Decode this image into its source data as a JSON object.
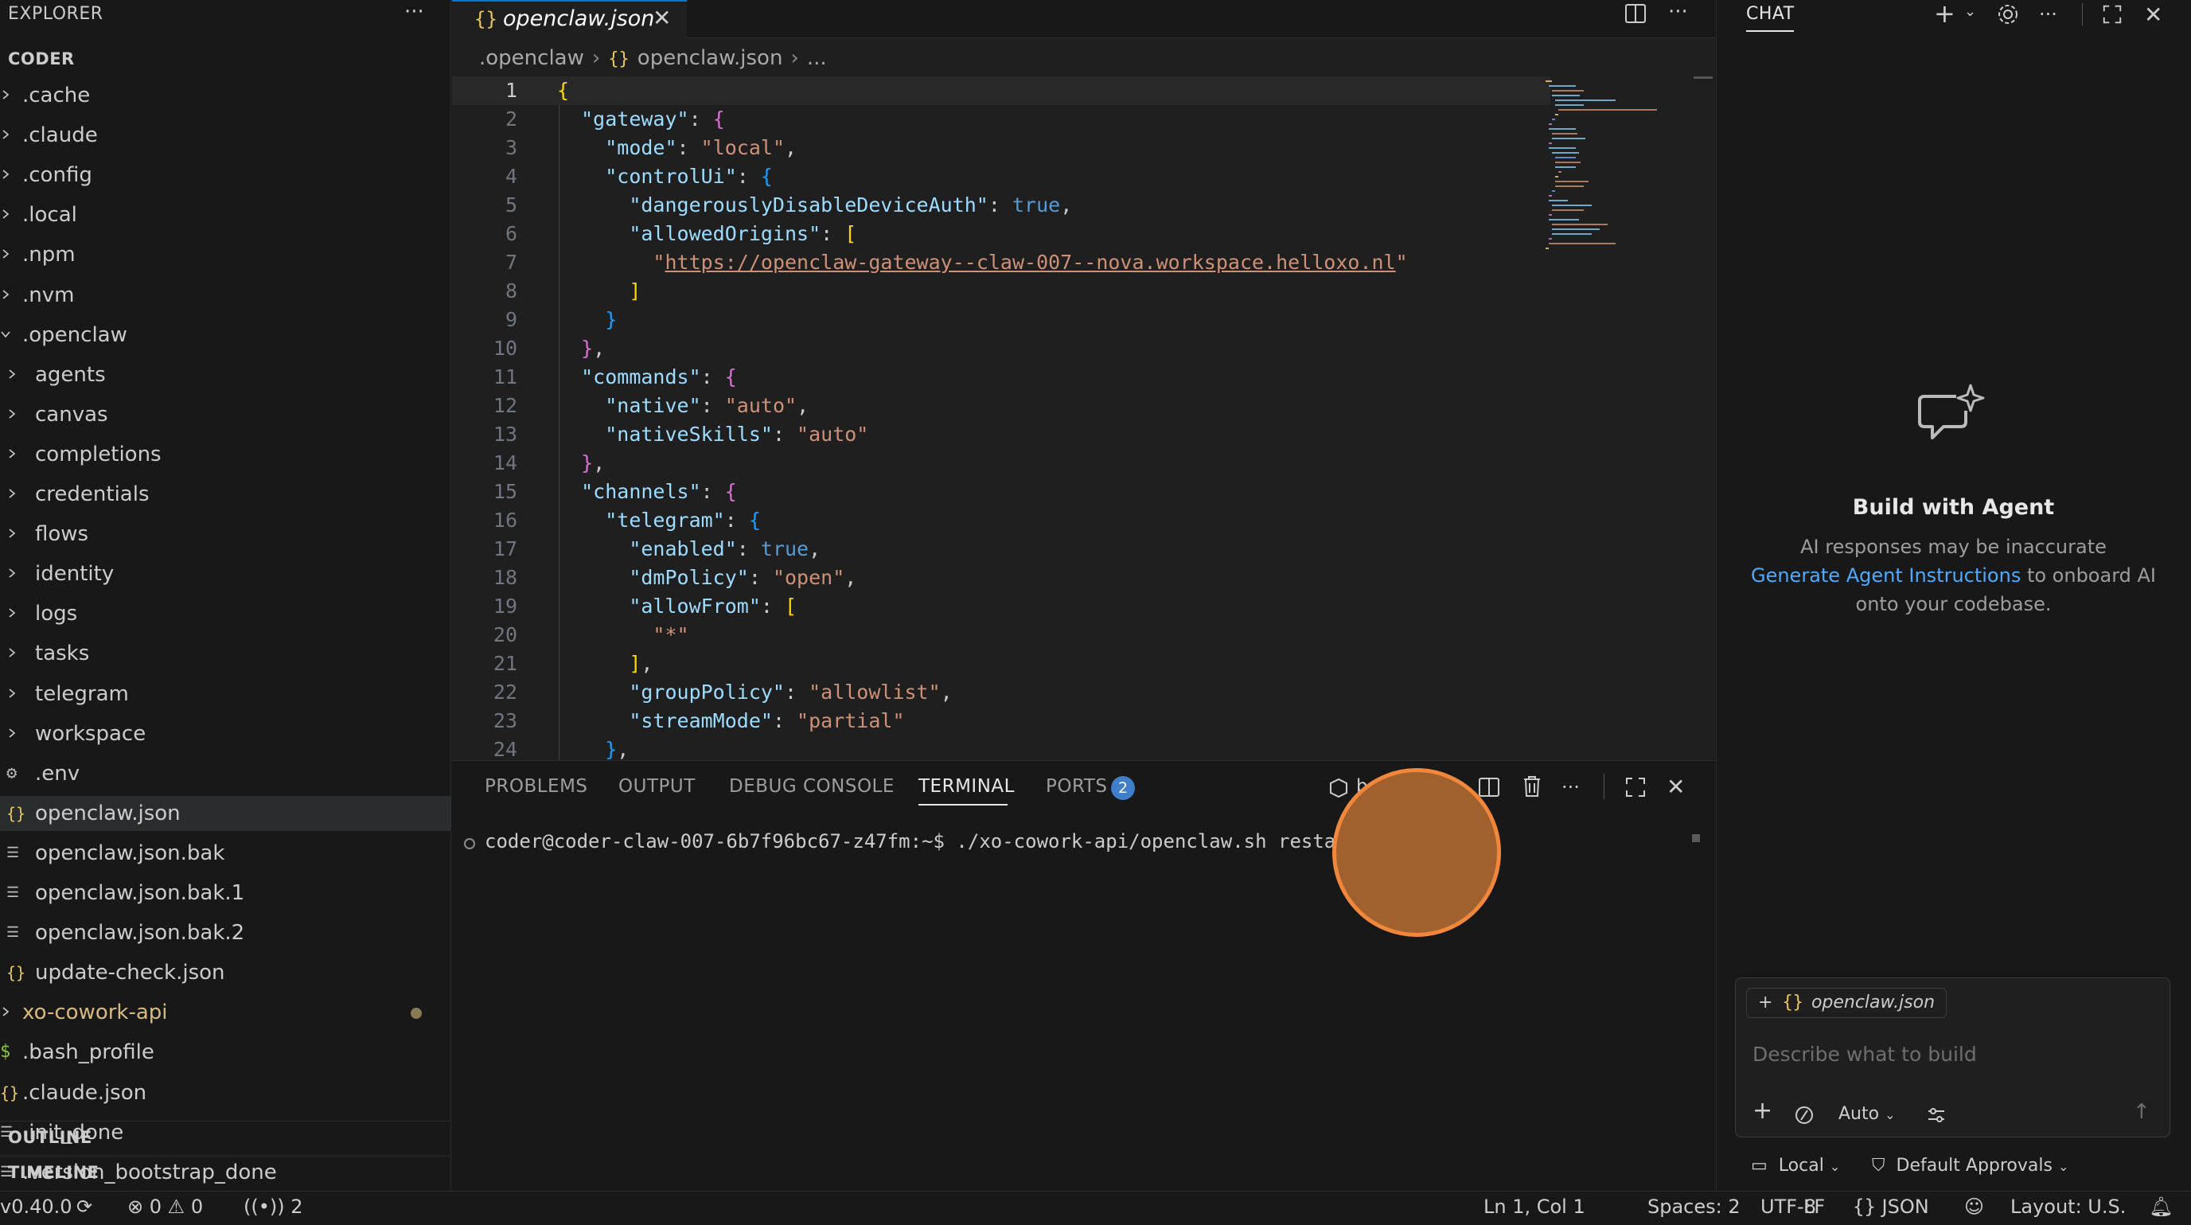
{
  "explorer": {
    "title": "EXPLORER",
    "more": "···",
    "root": "CODER",
    "items": [
      {
        "label": ".cache",
        "type": "folder",
        "expanded": false
      },
      {
        "label": ".claude",
        "type": "folder",
        "expanded": false
      },
      {
        "label": ".config",
        "type": "folder",
        "expanded": false
      },
      {
        "label": ".local",
        "type": "folder",
        "expanded": false
      },
      {
        "label": ".npm",
        "type": "folder",
        "expanded": false
      },
      {
        "label": ".nvm",
        "type": "folder",
        "expanded": false
      },
      {
        "label": ".openclaw",
        "type": "folder",
        "expanded": true
      },
      {
        "label": "agents",
        "type": "folder",
        "expanded": false
      },
      {
        "label": "canvas",
        "type": "folder",
        "expanded": false
      },
      {
        "label": "completions",
        "type": "folder",
        "expanded": false
      },
      {
        "label": "credentials",
        "type": "folder",
        "expanded": false
      },
      {
        "label": "flows",
        "type": "folder",
        "expanded": false
      },
      {
        "label": "identity",
        "type": "folder",
        "expanded": false
      },
      {
        "label": "logs",
        "type": "folder",
        "expanded": false
      },
      {
        "label": "tasks",
        "type": "folder",
        "expanded": false
      },
      {
        "label": "telegram",
        "type": "folder",
        "expanded": false
      },
      {
        "label": "workspace",
        "type": "folder",
        "expanded": false
      },
      {
        "label": ".env",
        "type": "file",
        "icon": "gear-icon"
      },
      {
        "label": "openclaw.json",
        "type": "file",
        "icon": "json-icon",
        "selected": true
      },
      {
        "label": "openclaw.json.bak",
        "type": "file",
        "icon": "lines-icon"
      },
      {
        "label": "openclaw.json.bak.1",
        "type": "file",
        "icon": "lines-icon"
      },
      {
        "label": "openclaw.json.bak.2",
        "type": "file",
        "icon": "lines-icon"
      },
      {
        "label": "update-check.json",
        "type": "file",
        "icon": "json-icon"
      },
      {
        "label": "xo-cowork-api",
        "type": "folder",
        "expanded": false,
        "modified": true
      },
      {
        "label": ".bash_profile",
        "type": "file",
        "icon": "dollar-icon"
      },
      {
        "label": ".claude.json",
        "type": "file",
        "icon": "json-icon"
      },
      {
        "label": ".init_done",
        "type": "file",
        "icon": "lines-icon"
      },
      {
        "label": ".version_bootstrap_done",
        "type": "file",
        "icon": "lines-icon"
      }
    ],
    "outline": "OUTLINE",
    "timeline": "TIMELINE"
  },
  "editor": {
    "tab_icon": "{}",
    "tab_label": "openclaw.json",
    "tab_close": "✕",
    "breadcrumb": [
      ".openclaw",
      "openclaw.json",
      "..."
    ],
    "lines": [
      "1",
      "2",
      "3",
      "4",
      "5",
      "6",
      "7",
      "8",
      "9",
      "10",
      "11",
      "12",
      "13",
      "14",
      "15",
      "16",
      "17",
      "18",
      "19",
      "20",
      "21",
      "22",
      "23",
      "24"
    ]
  },
  "panel": {
    "tabs": [
      "PROBLEMS",
      "OUTPUT",
      "DEBUG CONSOLE",
      "TERMINAL",
      "PORTS"
    ],
    "active_tab": "TERMINAL",
    "ports_badge": "2",
    "terminal_profile": "bash",
    "terminal_prompt": "coder@coder-claw-007-6b7f96bc67-z47fm:~$ ./xo-cowork-api/openclaw.sh restart"
  },
  "chat": {
    "title": "CHAT",
    "heading": "Build with Agent",
    "disclaimer": "AI responses may be inaccurate",
    "link": "Generate Agent Instructions",
    "link_suffix": " to onboard AI",
    "line3": "onto your codebase.",
    "attachment": "openclaw.json",
    "input_placeholder": "Describe what to build",
    "mode": "Auto",
    "location": "Local",
    "approvals": "Default Approvals"
  },
  "status": {
    "version": "v0.40.0",
    "errors": "0",
    "warnings": "0",
    "ports": "2",
    "position": "Ln 1, Col 1",
    "spaces": "Spaces: 2",
    "encoding": "UTF-8",
    "eol": "LF",
    "language": "JSON",
    "layout": "Layout: U.S."
  },
  "colors": {
    "accent": "#0078d4",
    "json_key": "#9cdcfe",
    "json_string": "#ce9178",
    "json_bool": "#569cd6",
    "cursor_highlight": "#f0873a"
  }
}
